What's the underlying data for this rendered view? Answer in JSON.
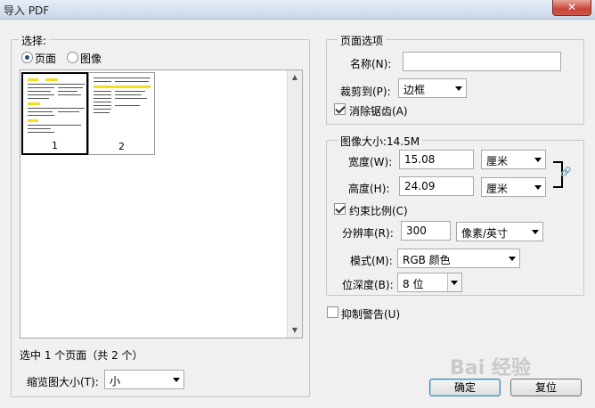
{
  "window": {
    "title": "导入 PDF",
    "close_glyph": "✕"
  },
  "select_group": {
    "legend": "选择:",
    "radio_page": "页面",
    "radio_image": "图像",
    "thumbnails": [
      {
        "label": "1",
        "selected": true
      },
      {
        "label": "2",
        "selected": false
      }
    ],
    "status": "选中 1 个页面（共 2 个）",
    "thumb_size_label": "缩览图大小(T):",
    "thumb_size_value": "小"
  },
  "page_options": {
    "legend": "页面选项",
    "name_label": "名称(N):",
    "name_value": "",
    "crop_label": "裁剪到(P):",
    "crop_value": "边框",
    "antialias_label": "消除锯齿(A)",
    "antialias_checked": true
  },
  "image_size": {
    "legend": "图像大小:14.5M",
    "width_label": "宽度(W):",
    "width_value": "15.08",
    "width_unit": "厘米",
    "height_label": "高度(H):",
    "height_value": "24.09",
    "height_unit": "厘米",
    "constrain_label": "约束比例(C)",
    "constrain_checked": true,
    "resolution_label": "分辨率(R):",
    "resolution_value": "300",
    "resolution_unit": "像素/英寸",
    "mode_label": "模式(M):",
    "mode_value": "RGB 颜色",
    "depth_label": "位深度(B):",
    "depth_value": "8 位"
  },
  "suppress_warnings_label": "抑制警告(U)",
  "suppress_warnings_checked": false,
  "buttons": {
    "ok": "确定",
    "reset": "复位"
  },
  "watermark": "Bai 经验"
}
